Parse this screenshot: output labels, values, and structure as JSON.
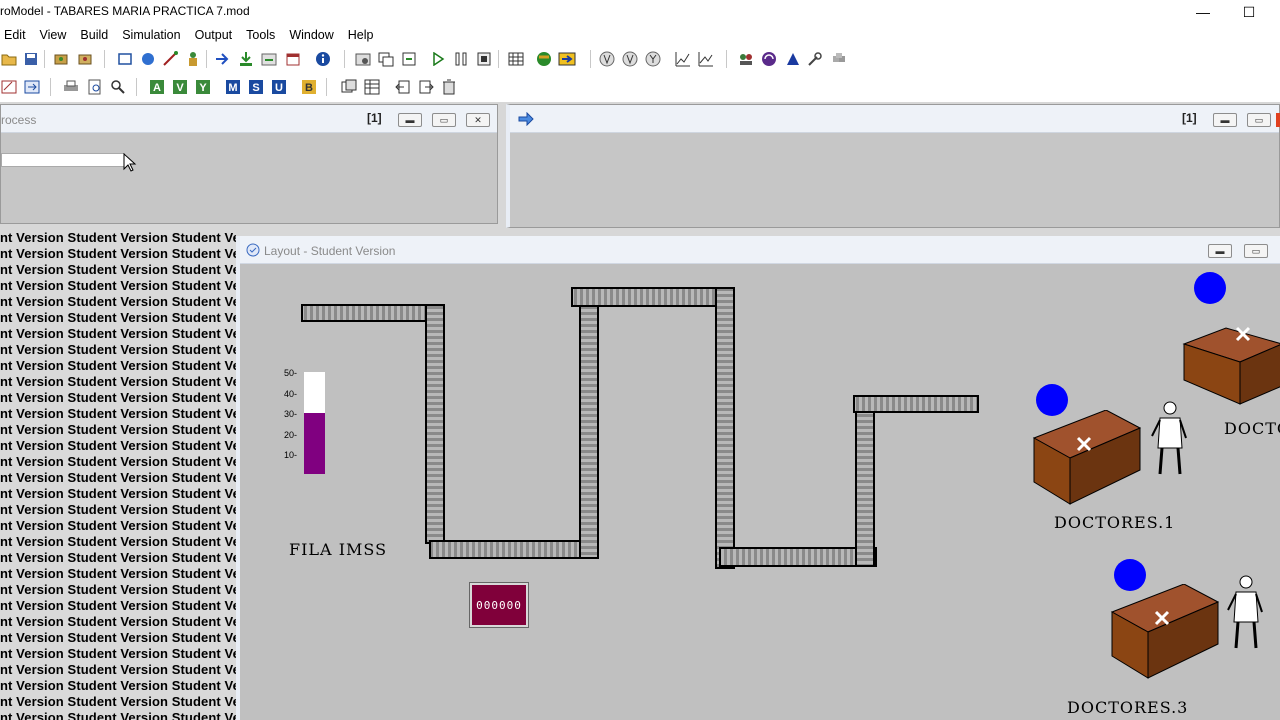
{
  "window": {
    "title": "roModel - TABARES MARIA PRACTICA 7.mod",
    "minimize_glyph": "—",
    "maximize_glyph": "☐"
  },
  "menu": [
    "Edit",
    "View",
    "Build",
    "Simulation",
    "Output",
    "Tools",
    "Window",
    "Help"
  ],
  "process_window": {
    "title": "rocess",
    "index": "[1]"
  },
  "right_window": {
    "index": "[1]"
  },
  "student_text": "nt Version Student Version Student Version Student Version",
  "student_rows": 31,
  "layout_window": {
    "title": "Layout - Student Version"
  },
  "gauge": {
    "ticks": [
      "50-",
      "40-",
      "30-",
      "20-",
      "10-"
    ],
    "level": 30,
    "max": 50,
    "fill_color": "#800080"
  },
  "labels": {
    "queue": "FILA IMSS",
    "doctor1": "DOCTORES.1",
    "doctor3": "DOCTORES.3",
    "doctor_partial": "DOCTO"
  },
  "counter": {
    "value": "000000"
  },
  "colors": {
    "entity": "#0000ff",
    "desk": "#8b4513",
    "conveyor": "#a9a9a9"
  }
}
